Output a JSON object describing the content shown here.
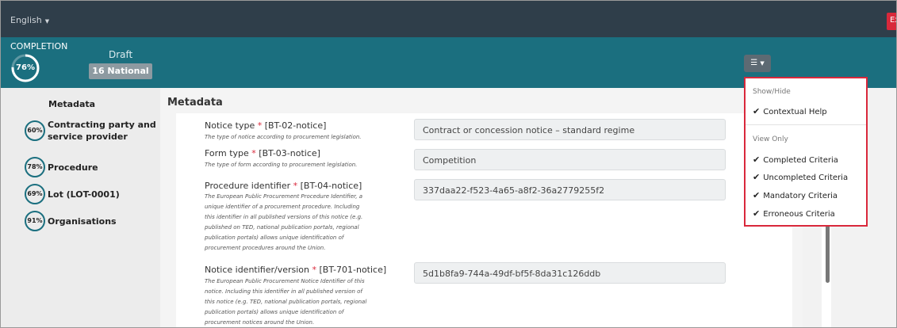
{
  "header": {
    "language": "English",
    "exit_label": "Exi"
  },
  "status": {
    "completion_label": "COMPLETION",
    "completion_percent": "76%",
    "completion_value": 0.76,
    "state": "Draft",
    "notice_badge": "16 National"
  },
  "sidebar": {
    "title": "Metadata",
    "items": [
      {
        "percent": "60%",
        "label_line1": "Contracting party and",
        "label_line2": "service provider"
      },
      {
        "percent": "78%",
        "label_line1": "Procedure",
        "label_line2": ""
      },
      {
        "percent": "69%",
        "label_line1": "Lot (LOT-0001)",
        "label_line2": ""
      },
      {
        "percent": "91%",
        "label_line1": "Organisations",
        "label_line2": ""
      }
    ]
  },
  "main": {
    "title": "Metadata",
    "fields": [
      {
        "label": "Notice type",
        "required": "*",
        "code": "[BT-02-notice]",
        "help": [
          "The type of notice according to procurement legislation."
        ],
        "value": "Contract or concession notice – standard regime"
      },
      {
        "label": "Form type",
        "required": "*",
        "code": "[BT-03-notice]",
        "help": [
          "The type of form according to procurement legislation."
        ],
        "value": "Competition"
      },
      {
        "label": "Procedure identifier",
        "required": "*",
        "code": "[BT-04-notice]",
        "help": [
          "The European Public Procurement Procedure Identifier, a",
          "unique identifier of a procurement procedure. Including",
          "this identifier in all published versions of this notice (e.g.",
          "published on TED, national publication portals, regional",
          "publication portals) allows unique identification of",
          "procurement procedures around the Union."
        ],
        "value": "337daa22-f523-4a65-a8f2-36a2779255f2"
      },
      {
        "label": "Notice identifier/version",
        "required": "*",
        "code": "[BT-701-notice]",
        "help": [
          "The European Public Procurement Notice Identifier of this",
          "notice. Including this identifier in all published version of",
          "this notice (e.g. TED, national publication portals, regional",
          "publication portals) allows unique identification of",
          "procurement notices around the Union."
        ],
        "value": "5d1b8fa9-744a-49df-bf5f-8da31c126ddb"
      }
    ]
  },
  "dropdown": {
    "show_hide_header": "Show/Hide",
    "show_hide_items": [
      "Contextual Help"
    ],
    "view_only_header": "View Only",
    "view_only_items": [
      "Completed Criteria",
      "Uncompleted Criteria",
      "Mandatory Criteria",
      "Erroneous Criteria"
    ],
    "check_glyph": "✔"
  },
  "colors": {
    "topbar": "#2f3e4a",
    "teal": "#1b6f7f",
    "highlight": "#d9283b"
  }
}
